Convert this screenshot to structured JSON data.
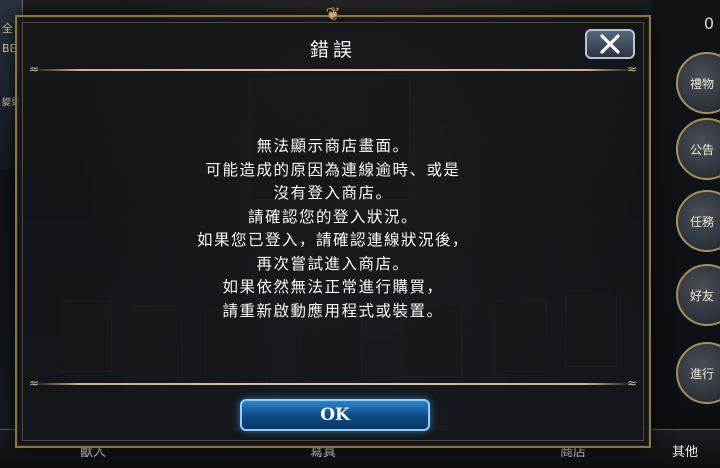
{
  "dialog": {
    "title": "錯誤",
    "message_lines": [
      "無法顯示商店畫面。",
      "可能造成的原因為連線逾時、或是",
      "沒有登入商店。",
      "請確認您的登入狀況。",
      "如果您已登入，請確認連線狀況後，",
      "再次嘗試進入商店。",
      "如果依然無法正常進行購買，",
      "請重新啟動應用程式或裝置。"
    ],
    "ok_label": "OK",
    "close_icon": "close-icon"
  },
  "background": {
    "top_right_number": "0",
    "top_left_texts": [
      "全",
      "BE",
      "變更"
    ],
    "side_buttons": [
      "禮物",
      "公告",
      "任務",
      "好友",
      "進行"
    ],
    "bottom_items": [
      "獸人",
      "寫真",
      "商店",
      "其他"
    ]
  },
  "colors": {
    "dialog_border": "#8a7448",
    "ok_button": "#1a5fa0",
    "close_button": "#3d4d5e"
  }
}
